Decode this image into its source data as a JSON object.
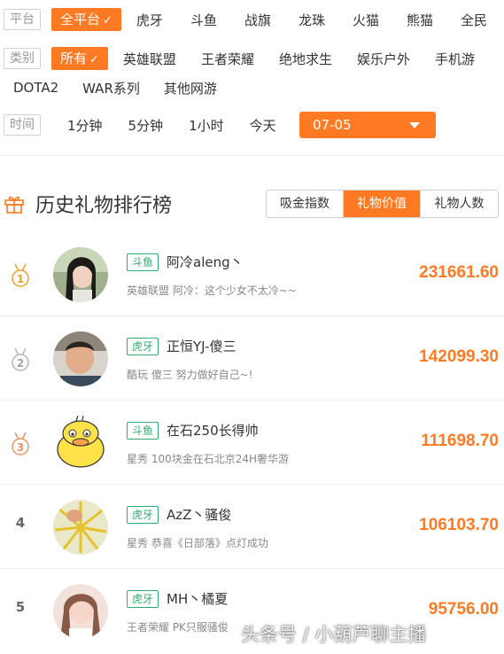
{
  "filters": {
    "platform": {
      "label": "平台",
      "options": [
        "全平台",
        "虎牙",
        "斗鱼",
        "战旗",
        "龙珠",
        "火猫",
        "熊猫",
        "全民"
      ],
      "active": 0
    },
    "category": {
      "label": "类别",
      "options": [
        "所有",
        "英雄联盟",
        "王者荣耀",
        "绝地求生",
        "娱乐户外",
        "手机游"
      ],
      "options_row2": [
        "DOTA2",
        "WAR系列",
        "其他网游"
      ],
      "active": 0
    },
    "time": {
      "label": "时间",
      "options": [
        "1分钟",
        "5分钟",
        "1小时",
        "今天"
      ],
      "date_value": "07-05"
    }
  },
  "section": {
    "title": "历史礼物排行榜",
    "tabs": [
      "吸金指数",
      "礼物价值",
      "礼物人数"
    ],
    "active_tab": 1
  },
  "rankings": [
    {
      "rank": "1",
      "platform": "斗鱼",
      "name": "阿冷aleng丶",
      "desc": "英雄联盟 阿冷：这个少女不太冷~~",
      "value": "231661.60",
      "medal": "gold"
    },
    {
      "rank": "2",
      "platform": "虎牙",
      "name": "正恒YJ-傻三",
      "desc": "酷玩 傻三 努力做好自己~!",
      "value": "142099.30",
      "medal": "silver"
    },
    {
      "rank": "3",
      "platform": "斗鱼",
      "name": "在石250长得帅",
      "desc": "星秀 100块金在石北京24H奢华游",
      "value": "111698.70",
      "medal": "bronze"
    },
    {
      "rank": "4",
      "platform": "虎牙",
      "name": "AzZ丶骚俊",
      "desc": "星秀 恭喜《日部落》点灯成功",
      "value": "106103.70",
      "medal": ""
    },
    {
      "rank": "5",
      "platform": "虎牙",
      "name": "MH丶橘夏",
      "desc": "王者荣耀 PK只服骚俊",
      "value": "95756.00",
      "medal": ""
    }
  ],
  "watermark": "头条号 / 小葫芦聊主播",
  "colors": {
    "accent": "#ff7a22",
    "platform_tag": "#2fae6f"
  }
}
